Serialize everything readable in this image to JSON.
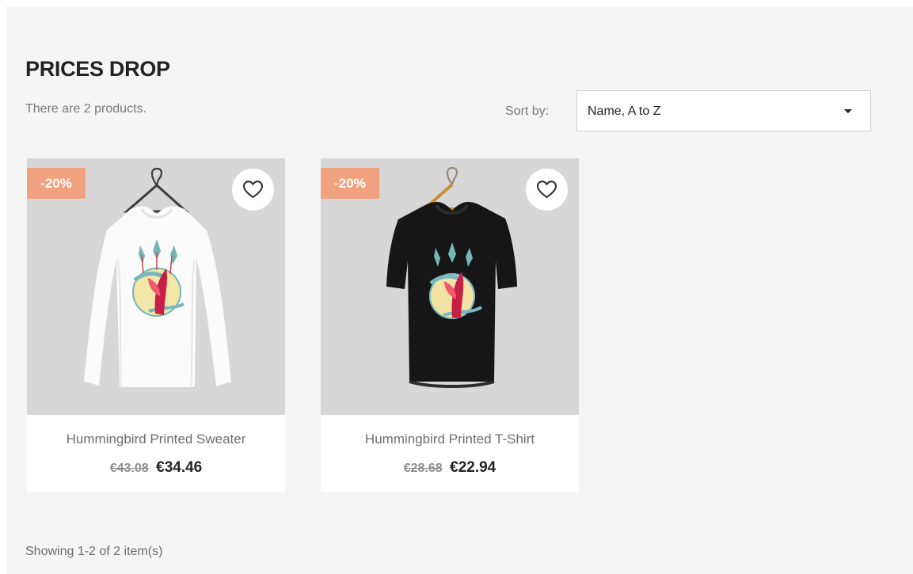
{
  "page": {
    "title": "PRICES DROP",
    "product_count_text": "There are 2 products."
  },
  "sort": {
    "label": "Sort by:",
    "selected": "Name, A to Z"
  },
  "products": [
    {
      "name": "Hummingbird Printed Sweater",
      "discount": "-20%",
      "old_price": "€43.08",
      "price": "€34.46",
      "image": "white-long-sleeve-hummingbird-sweater",
      "wishlist_icon": "heart-icon"
    },
    {
      "name": "Hummingbird Printed T-Shirt",
      "discount": "-20%",
      "old_price": "€28.68",
      "price": "€22.94",
      "image": "black-hummingbird-t-shirt",
      "wishlist_icon": "heart-icon"
    }
  ],
  "footer": {
    "showing_text": "Showing 1-2 of 2 item(s)"
  },
  "colors": {
    "background": "#f5f5f5",
    "discount_badge": "#f0a17d",
    "text_primary": "#232323",
    "text_muted": "#7a7a7a"
  },
  "icons": {
    "wishlist": "heart-icon",
    "sort_dropdown": "chevron-down-icon"
  }
}
